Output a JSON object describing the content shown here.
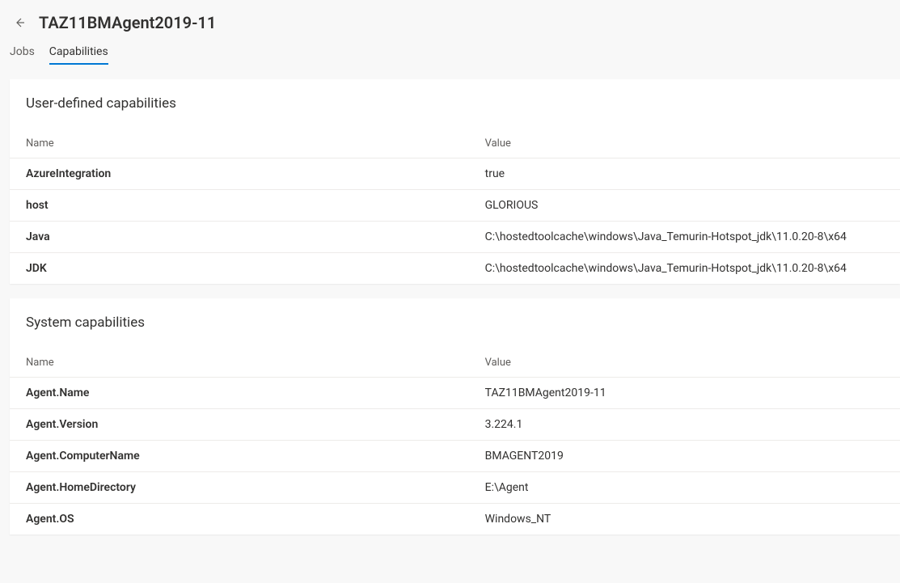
{
  "header": {
    "title": "TAZ11BMAgent2019-11"
  },
  "tabs": {
    "jobs": "Jobs",
    "capabilities": "Capabilities",
    "active": "capabilities"
  },
  "sections": {
    "userDefined": {
      "title": "User-defined capabilities",
      "columns": {
        "name": "Name",
        "value": "Value"
      },
      "rows": [
        {
          "name": "AzureIntegration",
          "value": "true"
        },
        {
          "name": "host",
          "value": "GLORIOUS"
        },
        {
          "name": "Java",
          "value": "C:\\hostedtoolcache\\windows\\Java_Temurin-Hotspot_jdk\\11.0.20-8\\x64"
        },
        {
          "name": "JDK",
          "value": "C:\\hostedtoolcache\\windows\\Java_Temurin-Hotspot_jdk\\11.0.20-8\\x64"
        }
      ]
    },
    "system": {
      "title": "System capabilities",
      "columns": {
        "name": "Name",
        "value": "Value"
      },
      "rows": [
        {
          "name": "Agent.Name",
          "value": "TAZ11BMAgent2019-11"
        },
        {
          "name": "Agent.Version",
          "value": "3.224.1"
        },
        {
          "name": "Agent.ComputerName",
          "value": "BMAGENT2019"
        },
        {
          "name": "Agent.HomeDirectory",
          "value": "E:\\Agent"
        },
        {
          "name": "Agent.OS",
          "value": "Windows_NT"
        }
      ]
    }
  }
}
